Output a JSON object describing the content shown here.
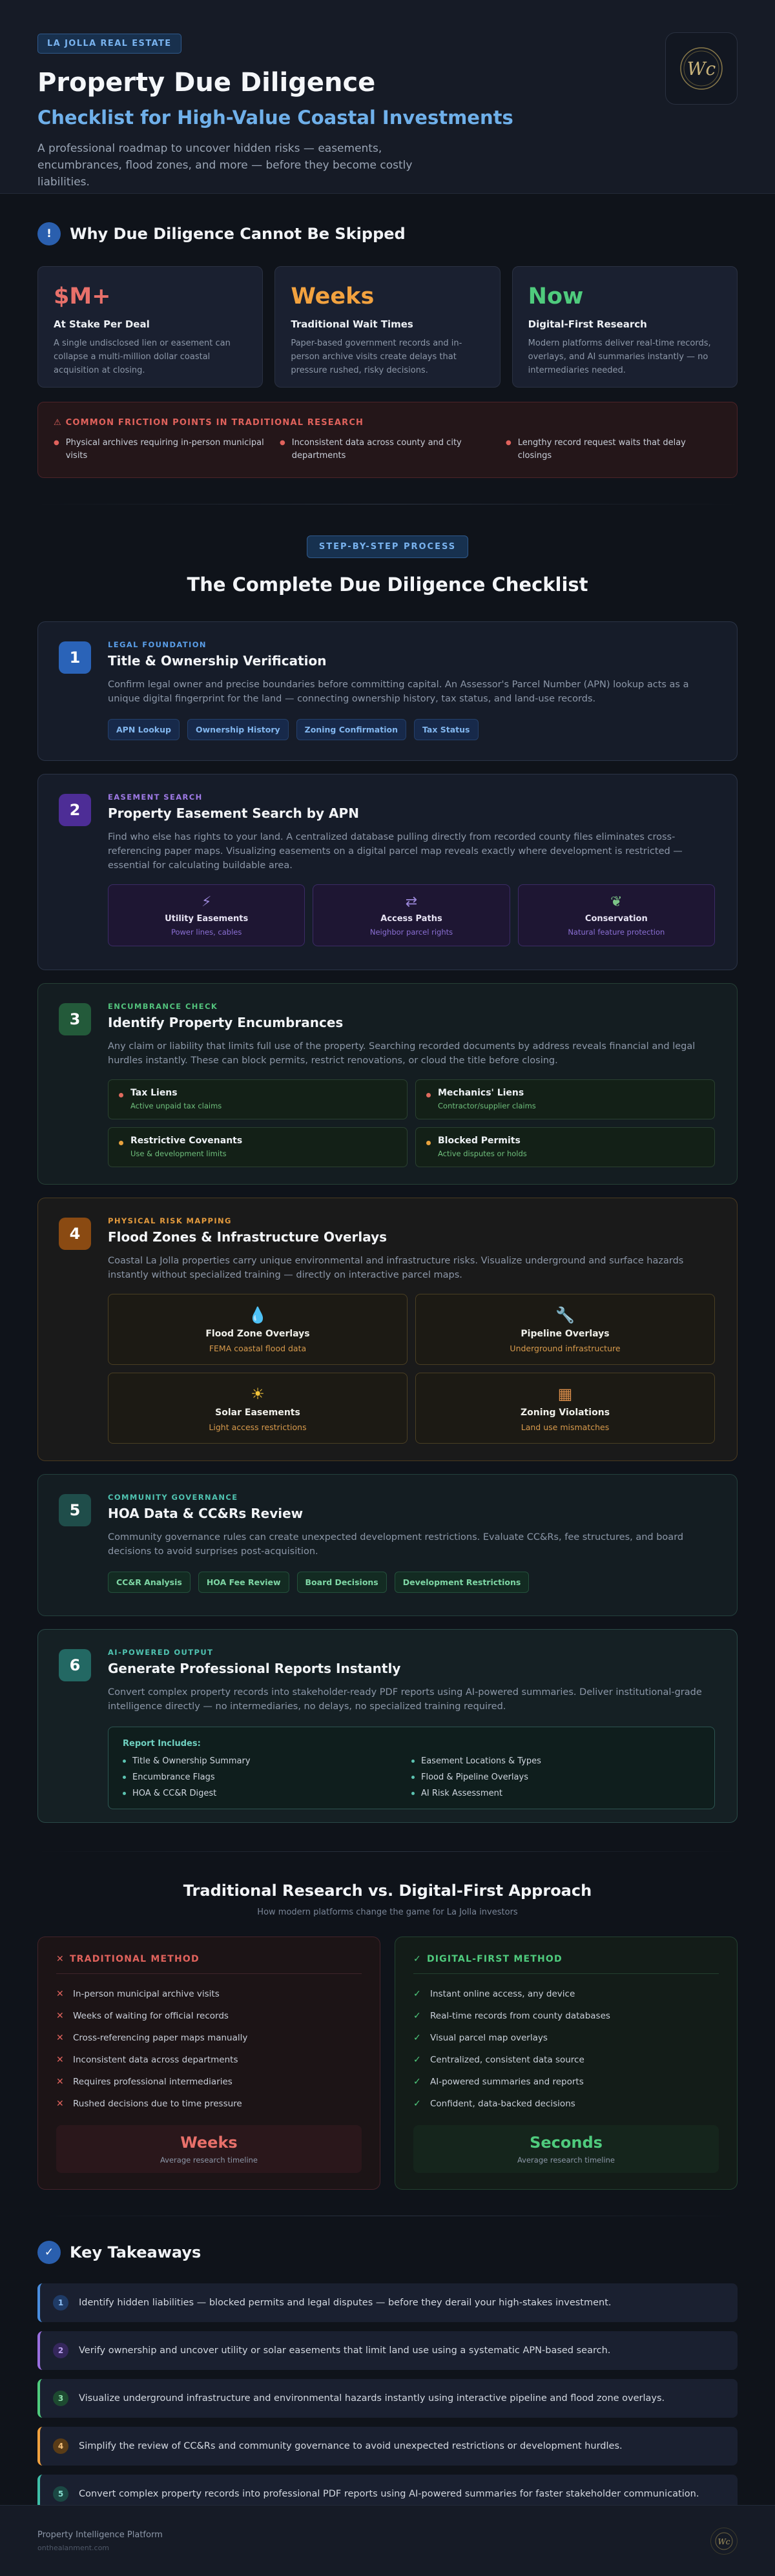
{
  "header": {
    "tag": "LA JOLLA REAL ESTATE",
    "title": "Property Due Diligence",
    "subtitle": "Checklist for High-Value Coastal Investments",
    "description": "A professional roadmap to uncover hidden risks — easements, encumbrances, flood zones, and more — before they become costly liabilities.",
    "logo_icon": "monogram-logo-icon"
  },
  "why": {
    "title": "Why Due Diligence Cannot Be Skipped",
    "stats": [
      {
        "value": "$M+",
        "label": "At Stake Per Deal",
        "desc": "A single undisclosed lien or easement can collapse a multi-million dollar coastal acquisition at closing.",
        "color": "#e8706a"
      },
      {
        "value": "Weeks",
        "label": "Traditional Wait Times",
        "desc": "Paper-based government records and in-person archive visits create delays that pressure rushed, risky decisions.",
        "color": "#f2a23f"
      },
      {
        "value": "Now",
        "label": "Digital-First Research",
        "desc": "Modern platforms deliver real-time records, overlays, and AI summaries instantly — no intermediaries needed.",
        "color": "#4fcb7d"
      }
    ],
    "friction_title": "COMMON FRICTION POINTS IN TRADITIONAL RESEARCH",
    "friction_items": [
      "Physical archives requiring in-person municipal visits",
      "Inconsistent data across county and city departments",
      "Lengthy record request waits that delay closings"
    ]
  },
  "process": {
    "tag": "STEP-BY-STEP PROCESS",
    "title": "The Complete Due Diligence Checklist"
  },
  "steps": [
    {
      "num": "1",
      "kicker": "LEGAL FOUNDATION",
      "title": "Title & Ownership Verification",
      "desc": "Confirm legal owner and precise boundaries before committing capital. An Assessor's Parcel Number (APN) lookup acts as a unique digital fingerprint for the land — connecting ownership history, tax status, and land-use records.",
      "chips": [
        "APN Lookup",
        "Ownership History",
        "Zoning Confirmation",
        "Tax Status"
      ]
    },
    {
      "num": "2",
      "kicker": "EASEMENT SEARCH",
      "title": "Property Easement Search by APN",
      "desc": "Find who else has rights to your land. A centralized database pulling directly from recorded county files eliminates cross-referencing paper maps. Visualizing easements on a digital parcel map reveals exactly where development is restricted — essential for calculating buildable area.",
      "tiles": [
        {
          "icon": "utility-icon",
          "name": "Utility Easements",
          "sub": "Power lines, cables"
        },
        {
          "icon": "access-path-icon",
          "name": "Access Paths",
          "sub": "Neighbor parcel rights"
        },
        {
          "icon": "conservation-leaf-icon",
          "name": "Conservation",
          "sub": "Natural feature protection"
        }
      ]
    },
    {
      "num": "3",
      "kicker": "ENCUMBRANCE CHECK",
      "title": "Identify Property Encumbrances",
      "desc": "Any claim or liability that limits full use of the property. Searching recorded documents by address reveals financial and legal hurdles instantly. These can block permits, restrict renovations, or cloud the title before closing.",
      "items": [
        {
          "name": "Tax Liens",
          "sub": "Active unpaid tax claims",
          "dot": "#e06b5e"
        },
        {
          "name": "Mechanics' Liens",
          "sub": "Contractor/supplier claims",
          "dot": "#e06b5e"
        },
        {
          "name": "Restrictive Covenants",
          "sub": "Use & development limits",
          "dot": "#e8a23d"
        },
        {
          "name": "Blocked Permits",
          "sub": "Active disputes or holds",
          "dot": "#e8a23d"
        }
      ]
    },
    {
      "num": "4",
      "kicker": "PHYSICAL RISK MAPPING",
      "title": "Flood Zones & Infrastructure Overlays",
      "desc": "Coastal La Jolla properties carry unique environmental and infrastructure risks. Visualize underground and surface hazards instantly without specialized training — directly on interactive parcel maps.",
      "tiles": [
        {
          "icon": "water-drop-icon",
          "name": "Flood Zone Overlays",
          "sub": "FEMA coastal flood data"
        },
        {
          "icon": "pipeline-wrench-icon",
          "name": "Pipeline Overlays",
          "sub": "Underground infrastructure"
        },
        {
          "icon": "sun-icon",
          "name": "Solar Easements",
          "sub": "Light access restrictions"
        },
        {
          "icon": "zoning-building-icon",
          "name": "Zoning Violations",
          "sub": "Land use mismatches"
        }
      ]
    },
    {
      "num": "5",
      "kicker": "COMMUNITY GOVERNANCE",
      "title": "HOA Data & CC&Rs Review",
      "desc": "Community governance rules can create unexpected development restrictions. Evaluate CC&Rs, fee structures, and board decisions to avoid surprises post-acquisition.",
      "chips": [
        "CC&R Analysis",
        "HOA Fee Review",
        "Board Decisions",
        "Development Restrictions"
      ]
    },
    {
      "num": "6",
      "kicker": "AI-POWERED OUTPUT",
      "title": "Generate Professional Reports Instantly",
      "desc": "Convert complex property records into stakeholder-ready PDF reports using AI-powered summaries. Deliver institutional-grade intelligence directly — no intermediaries, no delays, no specialized training required.",
      "report_title": "Report Includes:",
      "report_items": [
        "Title & Ownership Summary",
        "Easement Locations & Types",
        "Encumbrance Flags",
        "Flood & Pipeline Overlays",
        "HOA & CC&R Digest",
        "AI Risk Assessment"
      ]
    }
  ],
  "comparison": {
    "title": "Traditional Research vs. Digital-First Approach",
    "subtitle": "How modern platforms change the game for La Jolla investors",
    "traditional": {
      "head": "TRADITIONAL METHOD",
      "items": [
        "In-person municipal archive visits",
        "Weeks of waiting for official records",
        "Cross-referencing paper maps manually",
        "Inconsistent data across departments",
        "Requires professional intermediaries",
        "Rushed decisions due to time pressure"
      ],
      "value": "Weeks",
      "caption": "Average research timeline"
    },
    "digital": {
      "head": "DIGITAL-FIRST METHOD",
      "items": [
        "Instant online access, any device",
        "Real-time records from county databases",
        "Visual parcel map overlays",
        "Centralized, consistent data source",
        "AI-powered summaries and reports",
        "Confident, data-backed decisions"
      ],
      "value": "Seconds",
      "caption": "Average research timeline"
    }
  },
  "takeaways": {
    "title": "Key Takeaways",
    "items": [
      {
        "num": "1",
        "text": "Identify hidden liabilities — blocked permits and legal disputes — before they derail your high-stakes investment.",
        "color": "#4a8fe0"
      },
      {
        "num": "2",
        "text": "Verify ownership and uncover utility or solar easements that limit land use using a systematic APN-based search.",
        "color": "#9a6fe0"
      },
      {
        "num": "3",
        "text": "Visualize underground infrastructure and environmental hazards instantly using interactive pipeline and flood zone overlays.",
        "color": "#4fcb7d"
      },
      {
        "num": "4",
        "text": "Simplify the review of CC&Rs and community governance to avoid unexpected restrictions or development hurdles.",
        "color": "#f2a23f"
      },
      {
        "num": "5",
        "text": "Convert complex property records into professional PDF reports using AI-powered summaries for faster stakeholder communication.",
        "color": "#3fbfa8"
      }
    ]
  },
  "footer": {
    "brand": "Property Intelligence Platform",
    "url": "onthealanment.com"
  }
}
